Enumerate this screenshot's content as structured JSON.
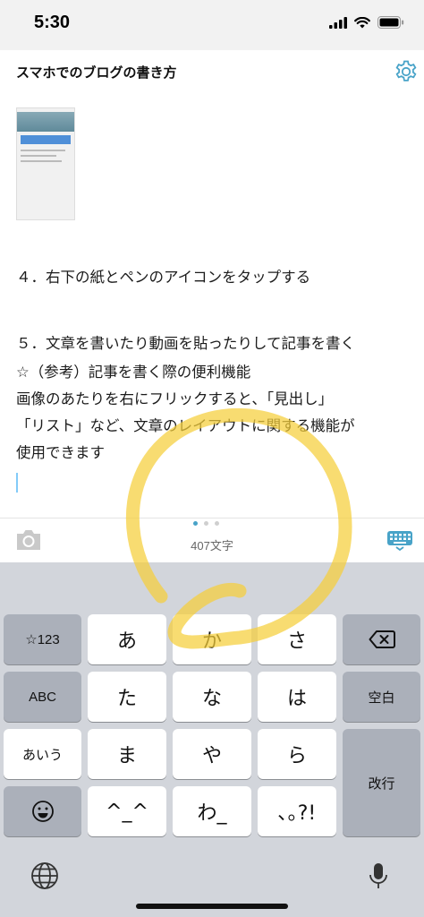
{
  "status": {
    "time": "5:30"
  },
  "header": {
    "title": "スマホでのブログの書き方"
  },
  "editor": {
    "lines": [
      "４．右下の紙とペンのアイコンをタップする",
      "５．文章を書いたり動画を貼ったりして記事を書く",
      "☆（参考）記事を書く際の便利機能",
      "画像のあたりを右にフリックすると、「見出し」",
      "「リスト」など、文章のレイアウトに関する機能が",
      "使用できます"
    ]
  },
  "toolbar": {
    "char_count": "407文字"
  },
  "keyboard": {
    "sym_key": "☆123",
    "abc_key": "ABC",
    "kana_key": "あいう",
    "space_key": "空白",
    "return_key": "改行",
    "row1": [
      "あ",
      "か",
      "さ"
    ],
    "row2": [
      "た",
      "な",
      "は"
    ],
    "row3": [
      "ま",
      "や",
      "ら"
    ],
    "row4": [
      "^_^",
      "わ_",
      "､｡?!"
    ]
  },
  "colors": {
    "accent": "#48a3c8",
    "highlighter": "#f5cf3a",
    "keyboard_bg": "#d2d5db"
  }
}
